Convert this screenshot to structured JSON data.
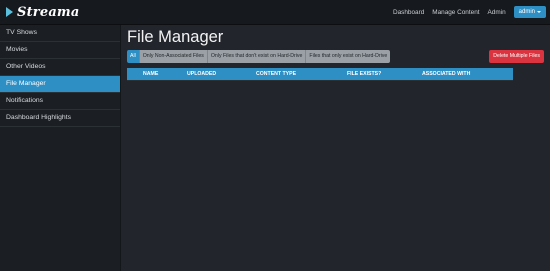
{
  "brand": {
    "name": "Streama"
  },
  "topnav": {
    "dashboard": "Dashboard",
    "manage_content": "Manage Content",
    "admin": "Admin",
    "user_button": "admin"
  },
  "sidebar": {
    "items": [
      {
        "label": "TV Shows",
        "active": false
      },
      {
        "label": "Movies",
        "active": false
      },
      {
        "label": "Other Videos",
        "active": false
      },
      {
        "label": "File Manager",
        "active": true
      },
      {
        "label": "Notifications",
        "active": false
      },
      {
        "label": "Dashboard Highlights",
        "active": false
      }
    ]
  },
  "main": {
    "title": "File Manager",
    "filters": [
      {
        "label": "All",
        "active": true
      },
      {
        "label": "Only Non-Associated Files",
        "active": false
      },
      {
        "label": "Only Files that don't exist on Hard-Drive",
        "active": false
      },
      {
        "label": "Files that only exist on Hard-Drive",
        "active": false
      }
    ],
    "delete_button": "Delete Multiple Files",
    "table": {
      "columns": [
        "NAME",
        "UPLOADED",
        "CONTENT TYPE",
        "FILE EXISTS?",
        "ASSOCIATED WITH"
      ]
    }
  },
  "colors": {
    "accent": "#2e8fc4",
    "danger": "#d9343f",
    "background": "#22262c",
    "sidebar": "#1b1f23"
  }
}
